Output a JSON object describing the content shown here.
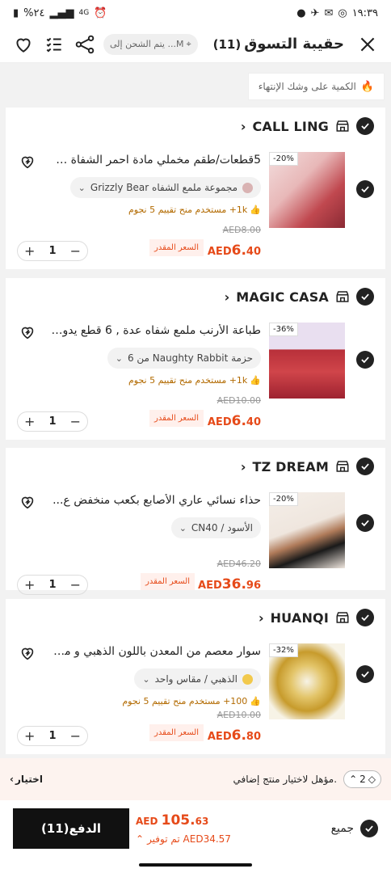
{
  "status_bar": {
    "time": "١٩:٣٩",
    "battery": "%٢٤",
    "network": "4G"
  },
  "header": {
    "title": "حقيبة التسوق",
    "count": "(11)",
    "ship_to": "يتم الشحن إلى ...M"
  },
  "banner": {
    "text": "الكمية على وشك الإنتهاء"
  },
  "items": [
    {
      "store": "CALL LING",
      "title": "5قطعات/طقم مخملي مادة احمر الشفاة سا...",
      "variant": "مجموعة ملمع الشفاه Grizzly Bear",
      "social": "1k+ مستخدم منح تقييم 5 نجوم",
      "discount": "-20%",
      "old_price": "AED8.00",
      "currency": "AED",
      "price_int": "6.",
      "price_dec": "40",
      "est_label": "السعر المقدر",
      "qty": "1"
    },
    {
      "store": "MAGIC CASA",
      "title": "طباعة الأرنب ملمع شفاه عدة , 6 قطع يدوم...",
      "variant": "حزمة Naughty Rabbit من 6",
      "social": "1k+ مستخدم منح تقييم 5 نجوم",
      "discount": "-36%",
      "old_price": "AED10.00",
      "currency": "AED",
      "price_int": "6.",
      "price_dec": "40",
      "est_label": "السعر المقدر",
      "qty": "1"
    },
    {
      "store": "TZ DREAM",
      "title": "حذاء نسائي عاري الأصابع بكعب منخفض ع...",
      "variant": "الأسود / CN40",
      "social": "",
      "discount": "-20%",
      "old_price": "AED46.20",
      "currency": "AED",
      "price_int": "36.",
      "price_dec": "96",
      "est_label": "السعر المقدر",
      "qty": "1"
    },
    {
      "store": "HUANQI",
      "title": "سوار معصم من المعدن باللون الذهبي و مر...",
      "variant": "الذهبي / مقاس واحد",
      "social": "100+ مستخدم منح تقييم 5 نجوم",
      "discount": "-32%",
      "old_price": "AED10.00",
      "currency": "AED",
      "price_int": "6.",
      "price_dec": "80",
      "est_label": "السعر المقدر",
      "qty": "1"
    }
  ],
  "promo": {
    "text": "مؤهل لاختيار منتج إضافي.",
    "count": "2",
    "action": "اختيار"
  },
  "checkout": {
    "pay_label": "الدفع(11)",
    "currency": "AED",
    "total_int": "105.",
    "total_dec": "63",
    "savings": "تم توفير AED34.57",
    "all_label": "جميع"
  },
  "colors": {
    "accent": "#e64a19",
    "dark": "#111111"
  }
}
